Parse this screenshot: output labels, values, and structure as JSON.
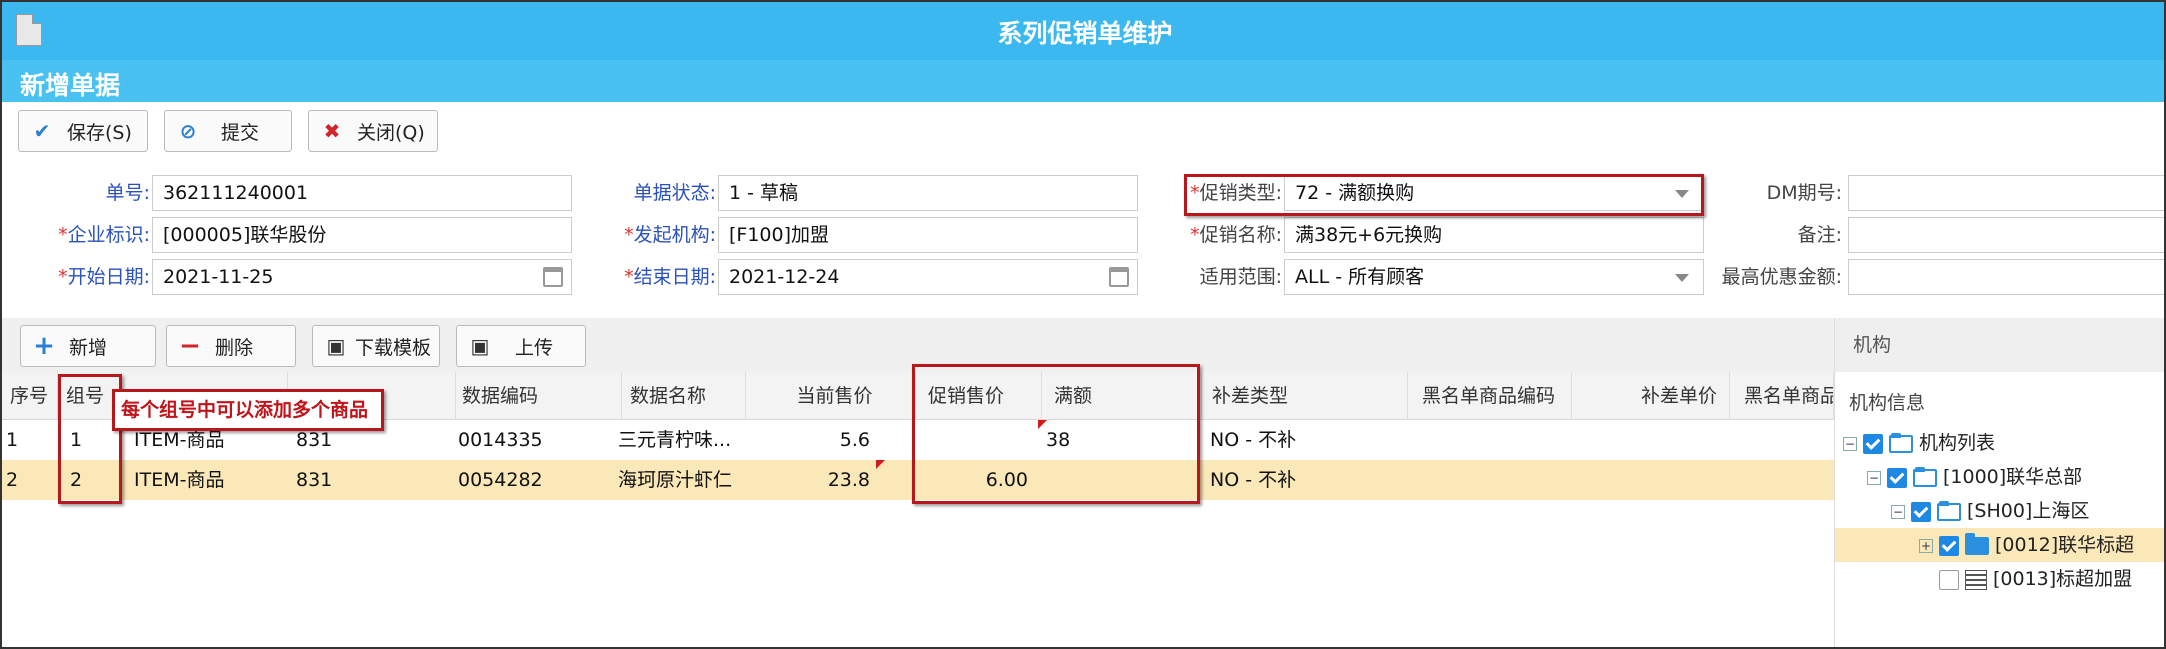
{
  "window": {
    "title": "系列促销单维护"
  },
  "page": {
    "subtitle": "新增单据"
  },
  "toolbar": {
    "save": "保存(S)",
    "submit": "提交",
    "close": "关闭(Q)"
  },
  "form": {
    "order_no": {
      "label": "单号:",
      "value": "362111240001"
    },
    "status": {
      "label": "单据状态:",
      "value": "1 - 草稿"
    },
    "promo_type": {
      "label": "促销类型:",
      "value": "72 - 满额换购"
    },
    "dm_period": {
      "label": "DM期号:",
      "value": ""
    },
    "company": {
      "label": "企业标识:",
      "value": "[000005]联华股份"
    },
    "origin_org": {
      "label": "发起机构:",
      "value": "[F100]加盟"
    },
    "promo_name": {
      "label": "促销名称:",
      "value": "满38元+6元换购"
    },
    "remark": {
      "label": "备注:",
      "value": ""
    },
    "start_date": {
      "label": "开始日期:",
      "value": "2021-11-25"
    },
    "end_date": {
      "label": "结束日期:",
      "value": "2021-12-24"
    },
    "scope": {
      "label": "适用范围:",
      "value": "ALL - 所有顾客"
    },
    "max_discount": {
      "label": "最高优惠金额:",
      "value": ""
    }
  },
  "grid_toolbar": {
    "add": "新增",
    "delete": "删除",
    "download": "下载模板",
    "upload": "上传"
  },
  "grid": {
    "columns": [
      "序号",
      "组号",
      "",
      "",
      "数据编码",
      "数据名称",
      "当前售价",
      "促销售价",
      "满额",
      "补差类型",
      "黑名单商品编码",
      "补差单价",
      "黑名单商品"
    ],
    "rows": [
      {
        "seq": "1",
        "group": "1",
        "type": "ITEM-商品",
        "code1": "831",
        "code": "0014335",
        "name": "三元青柠味...",
        "price": "5.6",
        "promo_price": "",
        "threshold": "38",
        "diff_type": "NO - 不补"
      },
      {
        "seq": "2",
        "group": "2",
        "type": "ITEM-商品",
        "code1": "831",
        "code": "0054282",
        "name": "海珂原汁虾仁",
        "price": "23.8",
        "promo_price": "6.00",
        "threshold": "",
        "diff_type": "NO - 不补"
      }
    ]
  },
  "annotation": {
    "callout": "每个组号中可以添加多个商品"
  },
  "panel": {
    "header": "机构",
    "info": "机构信息",
    "tree": [
      {
        "label": "机构列表"
      },
      {
        "label": "[1000]联华总部"
      },
      {
        "label": "[SH00]上海区"
      },
      {
        "label": "[0012]联华标超"
      },
      {
        "label": "[0013]标超加盟"
      }
    ]
  },
  "colors": {
    "titlebar": "#3bb8f0",
    "highlight": "#fbe8b8",
    "annotation": "#b8171c"
  }
}
